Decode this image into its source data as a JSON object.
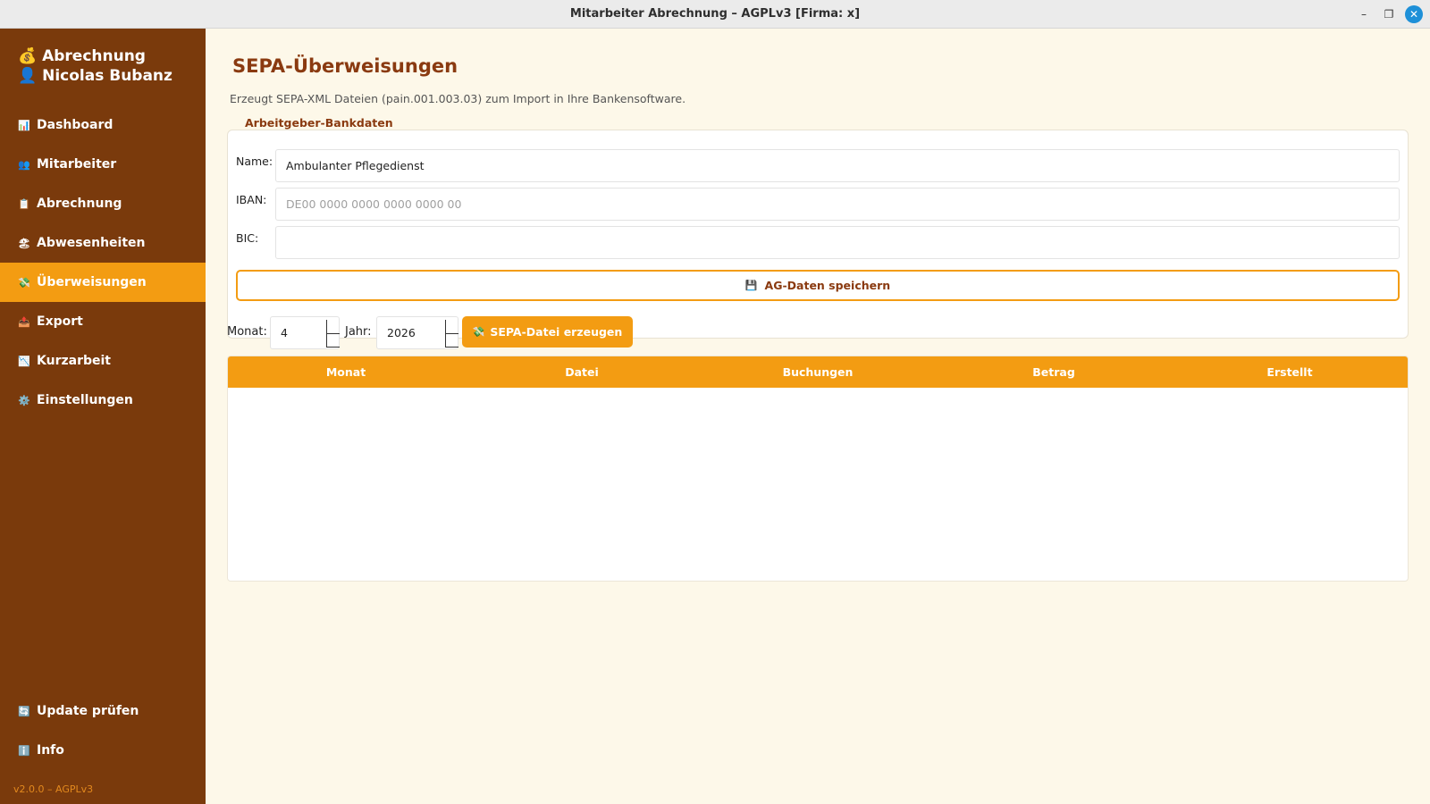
{
  "window": {
    "title": "Mitarbeiter Abrechnung – AGPLv3 [Firma: x]",
    "minimize_glyph": "–",
    "maximize_glyph": "❐",
    "close_glyph": "✕"
  },
  "sidebar": {
    "brand_line1": "💰 Abrechnung",
    "brand_line2": "👤 Nicolas Bubanz",
    "items": [
      {
        "icon": "📊",
        "icon_name": "chart-icon",
        "label": "Dashboard",
        "active": false
      },
      {
        "icon": "👥",
        "icon_name": "people-icon",
        "label": "Mitarbeiter",
        "active": false
      },
      {
        "icon": "📋",
        "icon_name": "clipboard-icon",
        "label": "Abrechnung",
        "active": false
      },
      {
        "icon": "🏖",
        "icon_name": "beach-icon",
        "label": "Abwesenheiten",
        "active": false
      },
      {
        "icon": "💸",
        "icon_name": "money-icon",
        "label": "Überweisungen",
        "active": true
      },
      {
        "icon": "📤",
        "icon_name": "outbox-icon",
        "label": "Export",
        "active": false
      },
      {
        "icon": "📉",
        "icon_name": "chart-down-icon",
        "label": "Kurzarbeit",
        "active": false
      },
      {
        "icon": "⚙️",
        "icon_name": "gear-icon",
        "label": "Einstellungen",
        "active": false
      }
    ],
    "bottom_items": [
      {
        "icon": "🔄",
        "icon_name": "refresh-icon",
        "label": "Update prüfen"
      },
      {
        "icon": "ℹ️",
        "icon_name": "info-icon",
        "label": "Info"
      }
    ],
    "version": "v2.0.0 – AGPLv3"
  },
  "main": {
    "title": "SEPA-Überweisungen",
    "subtitle": "Erzeugt SEPA-XML Dateien (pain.001.003.03) zum Import in Ihre Bankensoftware.",
    "group_title": "Arbeitgeber-Bankdaten",
    "name_label": "Name:",
    "name_value": "Ambulanter Pflegedienst",
    "iban_label": "IBAN:",
    "iban_value": "",
    "iban_placeholder": "DE00 0000 0000 0000 0000 00",
    "bic_label": "BIC:",
    "bic_value": "",
    "save_icon": "💾",
    "save_label": "AG-Daten speichern",
    "month_label": "Monat:",
    "month_value": "4",
    "year_label": "Jahr:",
    "year_value": "2026",
    "generate_icon": "💸",
    "generate_label": "SEPA-Datei erzeugen",
    "table_headers": [
      "Monat",
      "Datei",
      "Buchungen",
      "Betrag",
      "Erstellt"
    ],
    "table_rows": []
  },
  "colors": {
    "sidebar_bg": "#7a3a0c",
    "accent": "#f39c12",
    "title_color": "#8a3a10",
    "main_bg": "#fdf8e9"
  }
}
